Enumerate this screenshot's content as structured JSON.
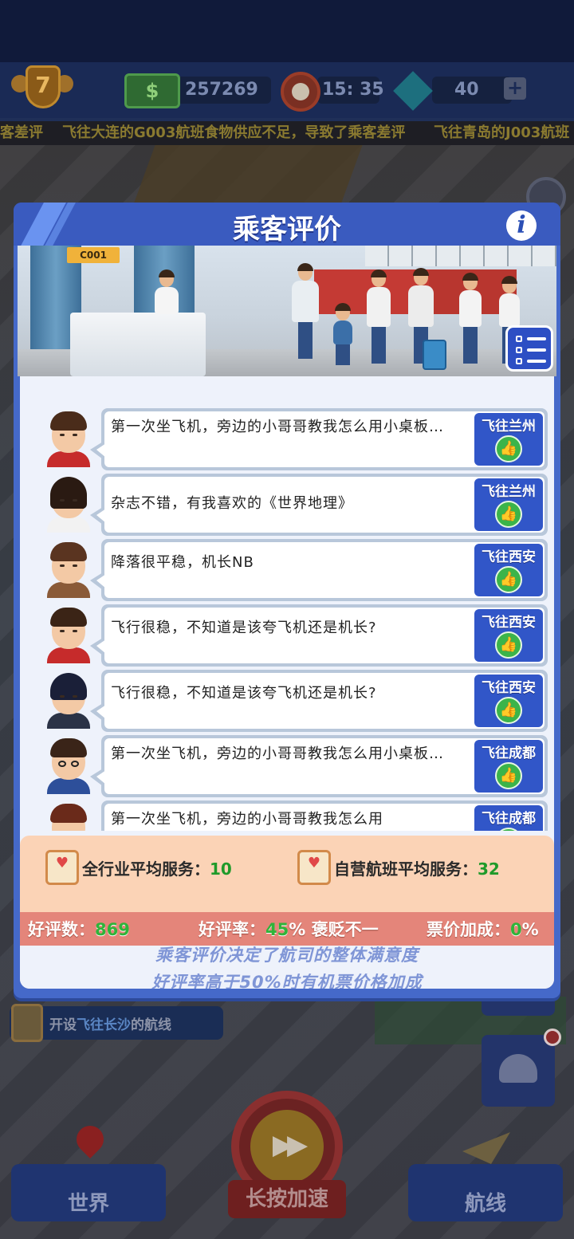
{
  "hud": {
    "level": "7",
    "money": "257269",
    "time": "15: 35",
    "gems": "40",
    "plus": "+"
  },
  "ticker": {
    "items": [
      "客差评",
      "飞往大连的G003航班食物供应不足，导致了乘客差评",
      "飞往青岛的J003航班"
    ]
  },
  "modal": {
    "title": "乘客评价",
    "info_icon": "i",
    "banner_sign": "C001"
  },
  "reviews": [
    {
      "text": "第一次坐飞机，旁边的小哥哥教我怎么用小桌板…",
      "destination": "飞往兰州",
      "avatar": "avatar-man-red-jacket",
      "rating": "thumbs-up"
    },
    {
      "text": "杂志不错，有我喜欢的《世界地理》",
      "destination": "飞往兰州",
      "avatar": "avatar-woman-long-hair",
      "rating": "thumbs-up"
    },
    {
      "text": "降落很平稳，机长NB",
      "destination": "飞往西安",
      "avatar": "avatar-man-brown-coat",
      "rating": "thumbs-up"
    },
    {
      "text": "飞行很稳，不知道是该夸飞机还是机长?",
      "destination": "飞往西安",
      "avatar": "avatar-man-red-jacket-2",
      "rating": "thumbs-up"
    },
    {
      "text": "飞行很稳，不知道是该夸飞机还是机长?",
      "destination": "飞往西安",
      "avatar": "avatar-woman-dark-hair",
      "rating": "thumbs-up"
    },
    {
      "text": "第一次坐飞机，旁边的小哥哥教我怎么用小桌板…",
      "destination": "飞往成都",
      "avatar": "avatar-man-glasses",
      "rating": "thumbs-up"
    },
    {
      "text": "第一次坐飞机，旁边的小哥哥教我怎么用",
      "destination": "飞往成都",
      "avatar": "avatar-man-partial",
      "rating": "thumbs-up"
    }
  ],
  "stats": {
    "industry_label": "全行业平均服务：",
    "industry_value": "10",
    "own_label": "自营航班平均服务：",
    "own_value": "32",
    "good_count_label": "好评数：",
    "good_count_value": "869",
    "good_rate_label": "好评率：",
    "good_rate_value": "45",
    "good_rate_suffix": "% 褒贬不一",
    "fare_label": "票价加成：",
    "fare_value": "0",
    "fare_suffix": "%"
  },
  "footnotes": [
    "乘客评价决定了航司的整体满意度",
    "好评率高于50%时有机票价格加成"
  ],
  "background": {
    "task_prefix": "开设",
    "task_highlight": "飞往长沙",
    "task_suffix": "的航线",
    "world_button": "世界",
    "speed_button": "长按加速",
    "routes_button": "航线"
  },
  "colors": {
    "modal_blue": "#4569c9",
    "tag_blue": "#3156c8",
    "thumb_green": "#3bb44a",
    "rating_bar": "#e4857a",
    "stats_panel": "#fbd3b6",
    "value_green": "#1f9a2a",
    "footnote_text": "#7f95d6"
  }
}
